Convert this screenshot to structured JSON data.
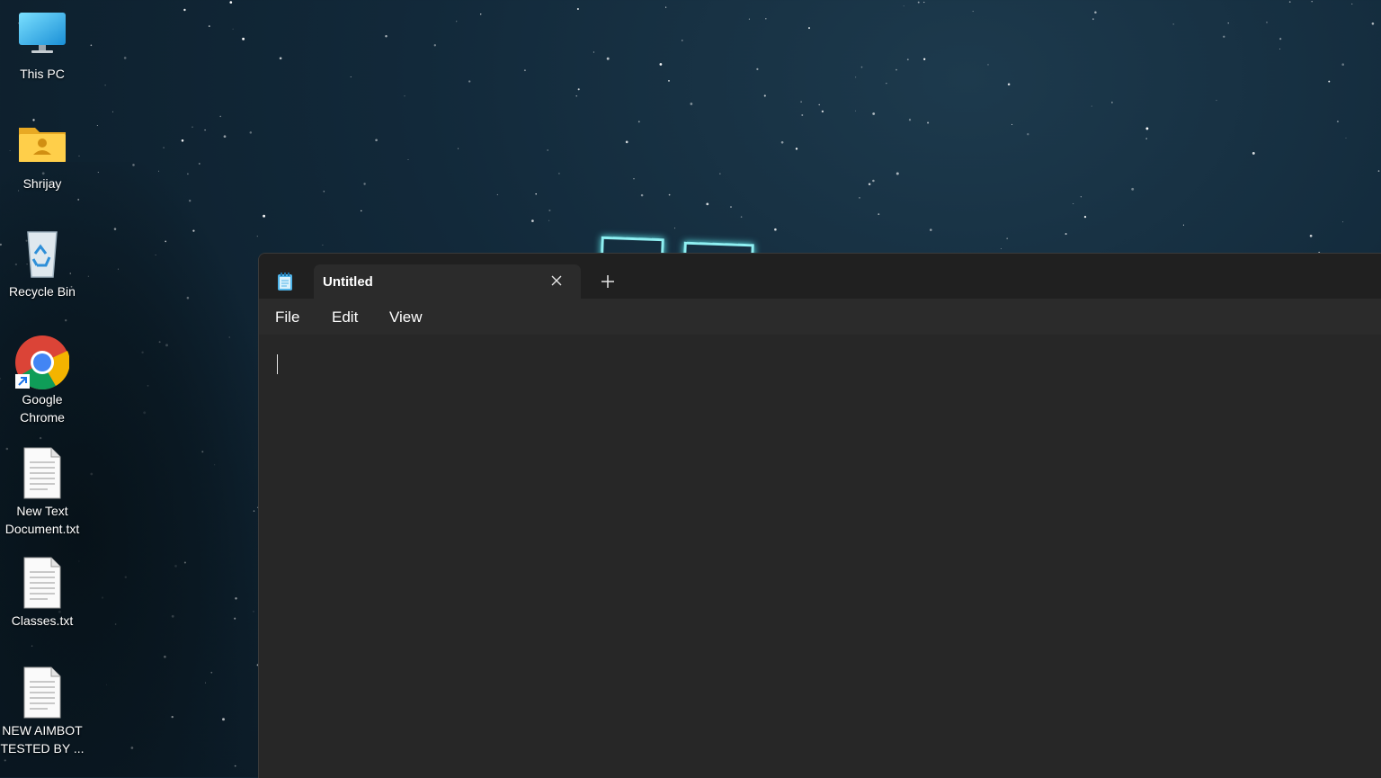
{
  "desktop": {
    "icons": [
      {
        "label": "This PC",
        "icon": "monitor-icon"
      },
      {
        "label": "Shrijay",
        "icon": "user-folder-icon"
      },
      {
        "label": "Recycle Bin",
        "icon": "recycle-bin-icon"
      },
      {
        "label": "Google Chrome",
        "icon": "chrome-icon"
      },
      {
        "label": "New Text Document.txt",
        "icon": "text-file-icon"
      },
      {
        "label": "Classes.txt",
        "icon": "text-file-icon"
      },
      {
        "label": "NEW AIMBOT TESTED BY ...",
        "icon": "text-file-icon"
      }
    ]
  },
  "notepad": {
    "app_icon": "notepad-icon",
    "tab": {
      "title": "Untitled",
      "close_icon": "close-icon"
    },
    "new_tab_icon": "plus-icon",
    "menu": [
      "File",
      "Edit",
      "View"
    ],
    "editor": {
      "content": ""
    }
  },
  "colors": {
    "window_bg": "#272727",
    "titlebar_bg": "#202020",
    "menubar_bg": "#2b2b2b",
    "neon_accent": "#8ff0f2"
  }
}
